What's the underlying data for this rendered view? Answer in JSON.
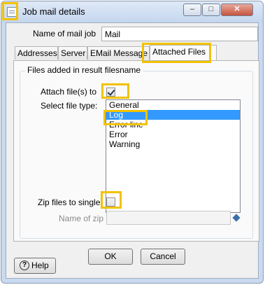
{
  "window": {
    "title": "Job mail details",
    "min_glyph": "–",
    "max_glyph": "□",
    "close_glyph": "✕"
  },
  "mail_job": {
    "label": "Name of mail job",
    "value": "Mail"
  },
  "tabs": [
    {
      "label": "Addresses",
      "active": false
    },
    {
      "label": "Server",
      "active": false
    },
    {
      "label": "EMail Message",
      "active": false
    },
    {
      "label": "Attached Files",
      "active": true
    }
  ],
  "group": {
    "title": "Files added in result filesname"
  },
  "attach_files": {
    "label": "Attach file(s) to",
    "checked": true
  },
  "file_type": {
    "label": "Select file type:",
    "options": [
      "General",
      "Log",
      "Error line",
      "Error",
      "Warning"
    ],
    "selected": "Log"
  },
  "zip_files": {
    "label": "Zip files to single",
    "checked": false
  },
  "zip_name": {
    "label": "Name of zip",
    "value": ""
  },
  "buttons": {
    "ok": "OK",
    "cancel": "Cancel",
    "help": "Help",
    "help_glyph": "?"
  },
  "colors": {
    "highlight": "#f2c200",
    "selection": "#3399ff"
  },
  "icons": {
    "app": "mail-window-icon",
    "variable": "variable-diamond-icon",
    "help": "help-circle-icon"
  }
}
